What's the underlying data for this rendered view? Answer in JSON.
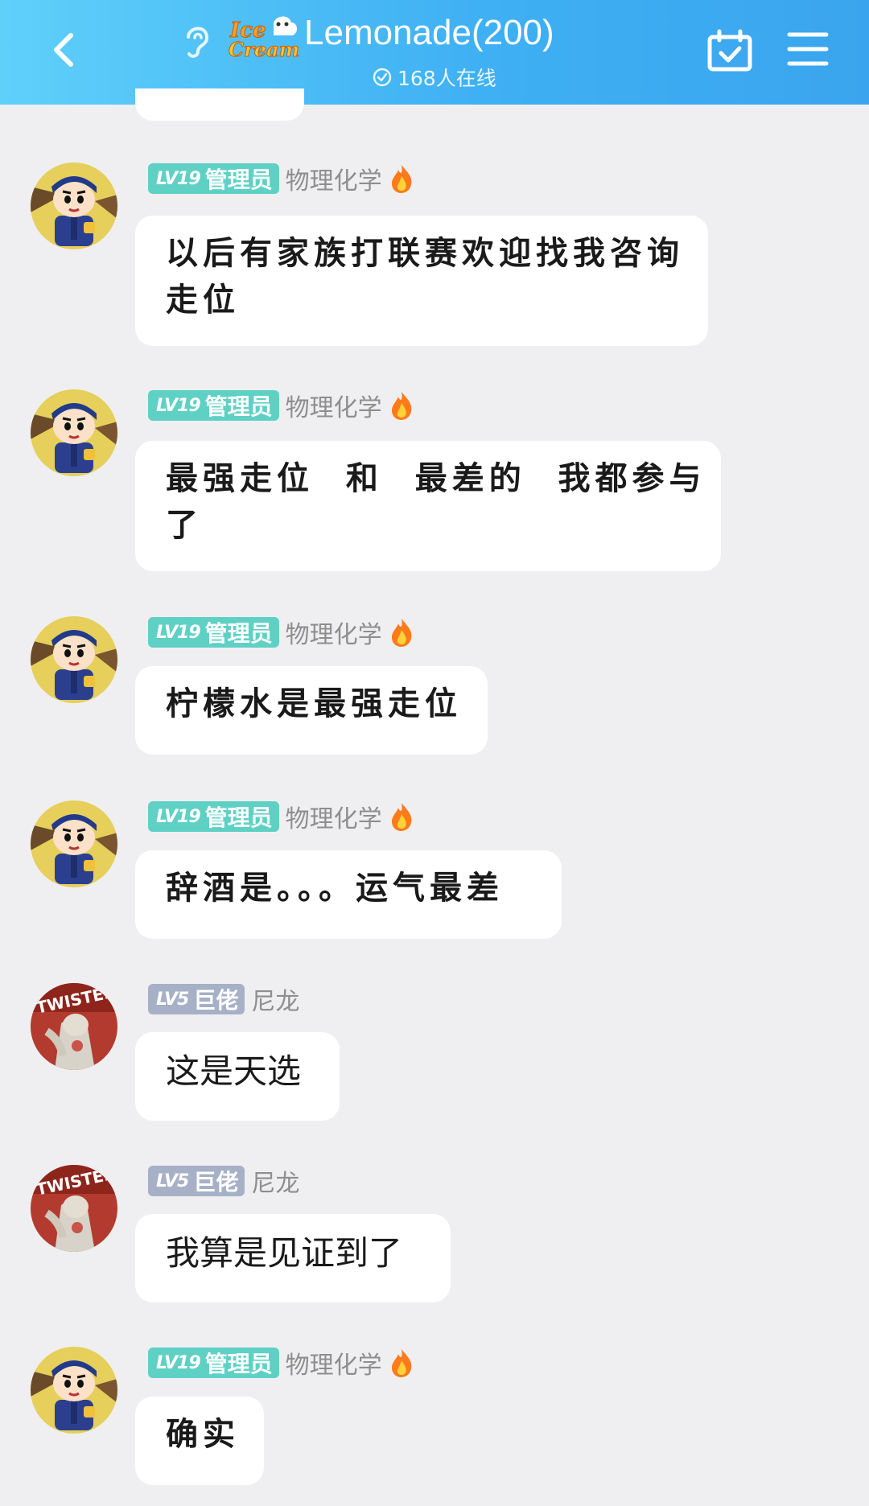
{
  "header": {
    "title": "Lemonade(200)",
    "online_text": "168人在线",
    "logo_text_top": "Ice",
    "logo_text_bottom": "Cream",
    "colors": {
      "bar_start": "#5fd0fa",
      "bar_end": "#3aa5ee"
    },
    "icons": [
      "back-arrow-icon",
      "ear-icon",
      "ice-cream-logo",
      "check-circle-icon",
      "calendar-check-icon",
      "menu-icon"
    ]
  },
  "messages": [
    {
      "badge_level": "LV19",
      "badge_title": "管理员",
      "badge_type": "admin",
      "username": "物理化学",
      "has_flame": true,
      "avatar": "cartoon-boy",
      "text": "以后有家族打联赛欢迎找我咨询\n走位"
    },
    {
      "badge_level": "LV19",
      "badge_title": "管理员",
      "badge_type": "admin",
      "username": "物理化学",
      "has_flame": true,
      "avatar": "cartoon-boy",
      "text": "最强走位  和  最差的  我都参与\n了"
    },
    {
      "badge_level": "LV19",
      "badge_title": "管理员",
      "badge_type": "admin",
      "username": "物理化学",
      "has_flame": true,
      "avatar": "cartoon-boy",
      "text": "柠檬水是最强走位"
    },
    {
      "badge_level": "LV19",
      "badge_title": "管理员",
      "badge_type": "admin",
      "username": "物理化学",
      "has_flame": true,
      "avatar": "cartoon-boy",
      "text": "辞酒是。。。运气最差"
    },
    {
      "badge_level": "LV5",
      "badge_title": "巨佬",
      "badge_type": "boss",
      "username": "尼龙",
      "has_flame": false,
      "avatar": "twisted-figure",
      "text": "这是天选"
    },
    {
      "badge_level": "LV5",
      "badge_title": "巨佬",
      "badge_type": "boss",
      "username": "尼龙",
      "has_flame": false,
      "avatar": "twisted-figure",
      "text": "我算是见证到了"
    },
    {
      "badge_level": "LV19",
      "badge_title": "管理员",
      "badge_type": "admin",
      "username": "物理化学",
      "has_flame": true,
      "avatar": "cartoon-boy",
      "text": "确实"
    }
  ]
}
